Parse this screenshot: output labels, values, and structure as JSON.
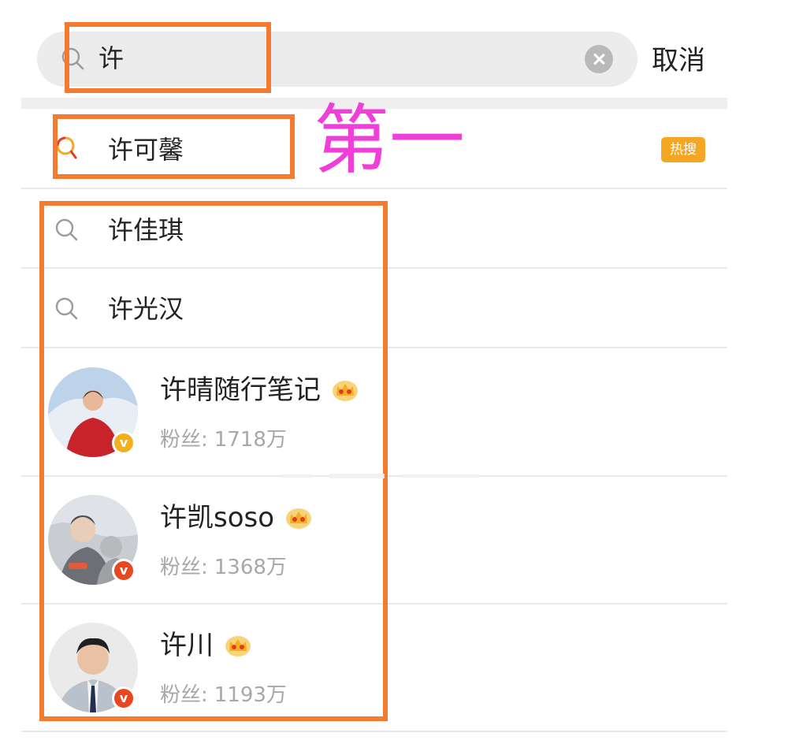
{
  "search": {
    "query": "许",
    "cancel_label": "取消"
  },
  "suggestions": [
    {
      "text": "许可馨",
      "icon": "hot-search-icon",
      "badge": "热搜"
    },
    {
      "text": "许佳琪",
      "icon": "search-icon"
    },
    {
      "text": "许光汉",
      "icon": "search-icon"
    }
  ],
  "users": [
    {
      "name": "许晴随行笔记",
      "fans_label": "粉丝:",
      "fans": "1718万",
      "verified_color": "#f2b01e",
      "crown": "crown-icon"
    },
    {
      "name": "许凯soso",
      "fans_label": "粉丝:",
      "fans": "1368万",
      "verified_color": "#e8471f",
      "crown": "crown-icon"
    },
    {
      "name": "许川",
      "fans_label": "粉丝:",
      "fans": "1193万",
      "verified_color": "#e8471f",
      "crown": "crown-icon"
    }
  ],
  "annotation": {
    "label": "第一",
    "label_color": "#f03ed8",
    "box_color": "#f47a30"
  },
  "colors": {
    "hot_badge": "#f5a623",
    "crown_gold": "#f2b01e",
    "crown_red": "#e23a2a"
  }
}
